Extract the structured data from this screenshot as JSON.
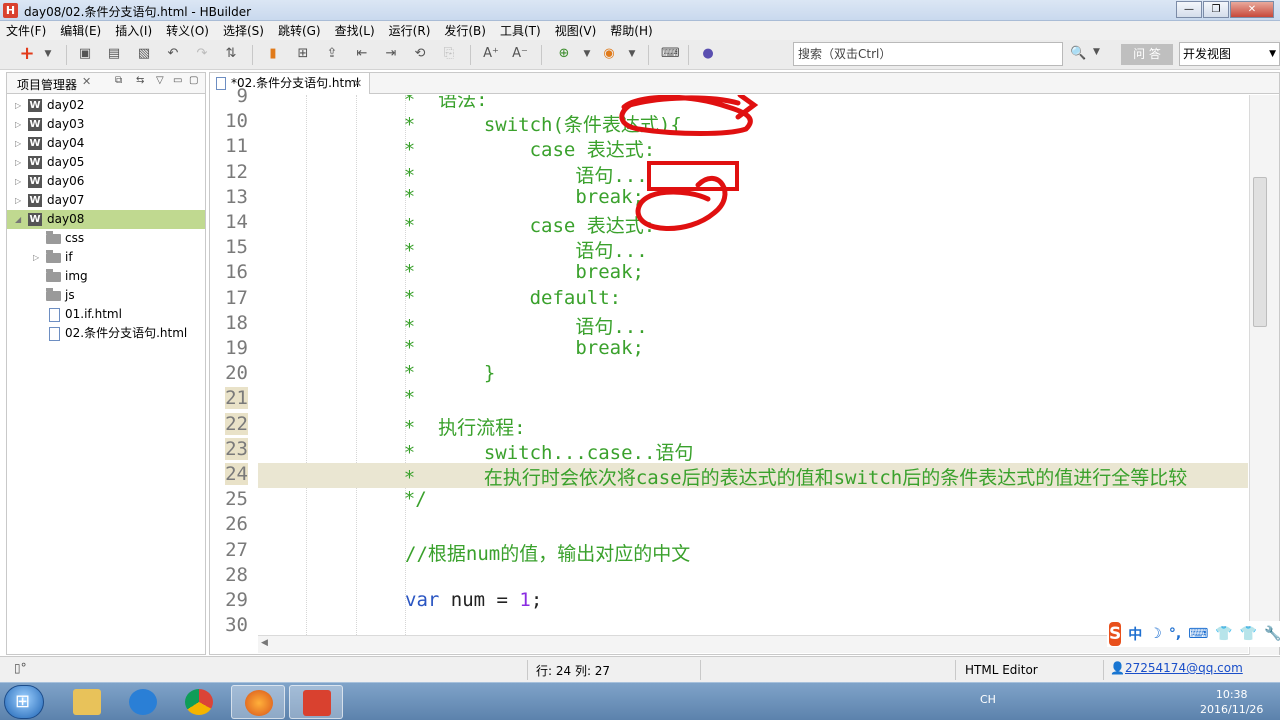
{
  "window": {
    "app_icon": "H",
    "title": "day08/02.条件分支语句.html  -  HBuilder",
    "buttons": [
      "—",
      "❐",
      "✕"
    ]
  },
  "menu": [
    "文件(F)",
    "编辑(E)",
    "插入(I)",
    "转义(O)",
    "选择(S)",
    "跳转(G)",
    "查找(L)",
    "运行(R)",
    "发行(B)",
    "工具(T)",
    "视图(V)",
    "帮助(H)"
  ],
  "toolbar": {
    "search_placeholder": "搜索（双击Ctrl）",
    "ask_label": "问 答",
    "view_label": "开发视图"
  },
  "project_panel": {
    "title": "项目管理器",
    "items": [
      {
        "label": "day02",
        "type": "project"
      },
      {
        "label": "day03",
        "type": "project"
      },
      {
        "label": "day04",
        "type": "project"
      },
      {
        "label": "day05",
        "type": "project"
      },
      {
        "label": "day06",
        "type": "project"
      },
      {
        "label": "day07",
        "type": "project"
      },
      {
        "label": "day08",
        "type": "project",
        "expanded": true,
        "selected": true
      },
      {
        "label": "css",
        "type": "folder"
      },
      {
        "label": "if",
        "type": "folder",
        "collapsible": true
      },
      {
        "label": "img",
        "type": "folder"
      },
      {
        "label": "js",
        "type": "folder"
      },
      {
        "label": "01.if.html",
        "type": "file"
      },
      {
        "label": "02.条件分支语句.html",
        "type": "file"
      }
    ]
  },
  "editor": {
    "tab_label": "*02.条件分支语句.html",
    "current_line": 24,
    "lines": [
      {
        "n": "9",
        "text": "    *  语法:"
      },
      {
        "n": "10",
        "text": "    *      switch(条件表达式){"
      },
      {
        "n": "11",
        "text": "    *          case 表达式:"
      },
      {
        "n": "12",
        "text": "    *              语句..."
      },
      {
        "n": "13",
        "text": "    *              break;"
      },
      {
        "n": "14",
        "text": "    *          case 表达式:"
      },
      {
        "n": "15",
        "text": "    *              语句..."
      },
      {
        "n": "16",
        "text": "    *              break;"
      },
      {
        "n": "17",
        "text": "    *          default:"
      },
      {
        "n": "18",
        "text": "    *              语句..."
      },
      {
        "n": "19",
        "text": "    *              break;"
      },
      {
        "n": "20",
        "text": "    *      }"
      },
      {
        "n": "21",
        "text": "    *"
      },
      {
        "n": "22",
        "text": "    *  执行流程:"
      },
      {
        "n": "23",
        "text": "    *      switch...case..语句"
      },
      {
        "n": "24",
        "text": "    *      在执行时会依次将case后的表达式的值和switch后的条件表达式的值进行全等比较"
      },
      {
        "n": "25",
        "text": "    */"
      },
      {
        "n": "26",
        "text": ""
      },
      {
        "n": "27",
        "text": "//根据num的值，输出对应的中文"
      },
      {
        "n": "28",
        "text": ""
      },
      {
        "n": "29",
        "text": "var num = 1;"
      },
      {
        "n": "30",
        "text": ""
      }
    ]
  },
  "ime": {
    "logo": "S",
    "items": [
      "中",
      "☽",
      "°,",
      "⌨",
      "👕",
      "👕",
      "🔧"
    ]
  },
  "status": {
    "position": "行: 24 列: 27",
    "editor_type": "HTML Editor",
    "user": "27254174@qq.com"
  },
  "taskbar": {
    "tray_lang": "CH",
    "time": "10:38",
    "date": "2016/11/26"
  },
  "colors": {
    "comment_green": "#3aa12c",
    "keyword_blue": "#2a55c2",
    "number_purple": "#8a2be2",
    "selection_green": "#c0d990",
    "annotation_red": "#e01010"
  }
}
